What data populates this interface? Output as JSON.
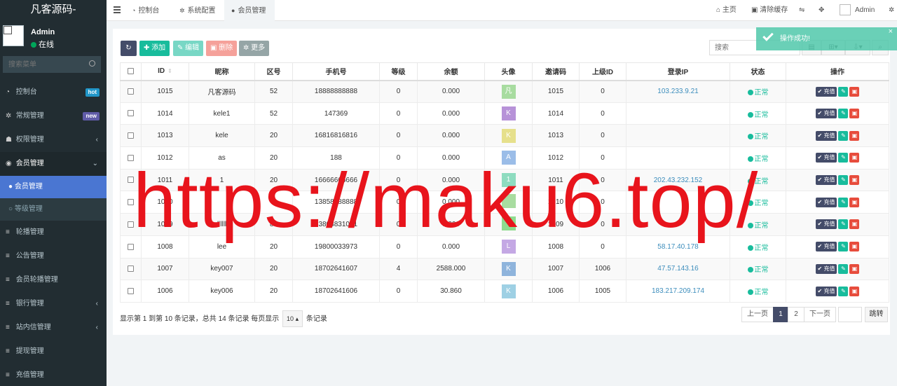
{
  "sidebar": {
    "logo": "凡客源码-",
    "user": {
      "name": "Admin",
      "status": "在线"
    },
    "search_placeholder": "搜索菜单",
    "items": [
      {
        "label": "控制台",
        "icon": "dashboard-icon",
        "badge": "hot"
      },
      {
        "label": "常规管理",
        "icon": "cogs-icon",
        "badge": "new"
      },
      {
        "label": "权限管理",
        "icon": "group-icon"
      },
      {
        "label": "会员管理",
        "icon": "user-circle-icon"
      },
      {
        "label": "轮播管理",
        "icon": "list-icon"
      },
      {
        "label": "公告管理",
        "icon": "list-icon"
      },
      {
        "label": "会员轮播管理",
        "icon": "list-icon"
      },
      {
        "label": "银行管理",
        "icon": "list-icon"
      },
      {
        "label": "站内信管理",
        "icon": "list-icon"
      },
      {
        "label": "提现管理",
        "icon": "list-icon"
      },
      {
        "label": "充值管理",
        "icon": "list-icon"
      }
    ],
    "sub_items": [
      {
        "label": "会员管理"
      },
      {
        "label": "等级管理"
      }
    ]
  },
  "topbar": {
    "tabs": [
      {
        "label": "控制台",
        "icon": "dashboard-icon"
      },
      {
        "label": "系统配置",
        "icon": "gear-icon"
      },
      {
        "label": "会员管理",
        "icon": "user-icon"
      }
    ],
    "right": {
      "home": "主页",
      "clear_cache": "清除缓存",
      "admin": "Admin"
    }
  },
  "toolbar": {
    "add": "添加",
    "edit": "编辑",
    "delete": "删除",
    "more": "更多",
    "search_placeholder": "搜索"
  },
  "table": {
    "headers": [
      "ID",
      "昵称",
      "区号",
      "手机号",
      "等级",
      "余额",
      "头像",
      "邀请码",
      "上级ID",
      "登录IP",
      "状态",
      "操作"
    ],
    "charge_label": "充值",
    "rows": [
      {
        "id": "1015",
        "nick": "凡客源码",
        "area": "52",
        "phone": "18888888888",
        "level": "0",
        "balance": "0.000",
        "avatar": "凡",
        "avatar_color": "#a8dca0",
        "invite": "1015",
        "parent": "0",
        "ip": "103.233.9.21",
        "status": "正常"
      },
      {
        "id": "1014",
        "nick": "kele1",
        "area": "52",
        "phone": "147369",
        "level": "0",
        "balance": "0.000",
        "avatar": "K",
        "avatar_color": "#b792d8",
        "invite": "1014",
        "parent": "0",
        "ip": "",
        "status": "正常"
      },
      {
        "id": "1013",
        "nick": "kele",
        "area": "20",
        "phone": "16816816816",
        "level": "0",
        "balance": "0.000",
        "avatar": "K",
        "avatar_color": "#e6e08c",
        "invite": "1013",
        "parent": "0",
        "ip": "",
        "status": "正常"
      },
      {
        "id": "1012",
        "nick": "as",
        "area": "20",
        "phone": "188",
        "level": "0",
        "balance": "0.000",
        "avatar": "A",
        "avatar_color": "#9bbde8",
        "invite": "1012",
        "parent": "0",
        "ip": "",
        "status": "正常"
      },
      {
        "id": "1011",
        "nick": "1",
        "area": "20",
        "phone": "16666666666",
        "level": "0",
        "balance": "0.000",
        "avatar": "1",
        "avatar_color": "#8edcc0",
        "invite": "1011",
        "parent": "0",
        "ip": "202.43.232.152",
        "status": "正常"
      },
      {
        "id": "1010",
        "nick": "",
        "area": "0",
        "phone": "13858888888",
        "level": "0",
        "balance": "0.000",
        "avatar": "",
        "avatar_color": "#a8dca0",
        "invite": "1010",
        "parent": "0",
        "ip": "",
        "status": "正常"
      },
      {
        "id": "1009",
        "nick": "llllll",
        "area": "86",
        "phone": "13808831081",
        "level": "0",
        "balance": "0.000",
        "avatar": "",
        "avatar_color": "#8edc8e",
        "invite": "1009",
        "parent": "0",
        "ip": "",
        "status": "正常"
      },
      {
        "id": "1008",
        "nick": "lee",
        "area": "20",
        "phone": "19800033973",
        "level": "0",
        "balance": "0.000",
        "avatar": "L",
        "avatar_color": "#c4a8e4",
        "invite": "1008",
        "parent": "0",
        "ip": "58.17.40.178",
        "status": "正常"
      },
      {
        "id": "1007",
        "nick": "key007",
        "area": "20",
        "phone": "18702641607",
        "level": "4",
        "balance": "2588.000",
        "avatar": "K",
        "avatar_color": "#8fb4dc",
        "invite": "1007",
        "parent": "1006",
        "ip": "47.57.143.16",
        "status": "正常"
      },
      {
        "id": "1006",
        "nick": "key006",
        "area": "20",
        "phone": "18702641606",
        "level": "0",
        "balance": "30.860",
        "avatar": "K",
        "avatar_color": "#9ed0e4",
        "invite": "1006",
        "parent": "1005",
        "ip": "183.217.209.174",
        "status": "正常"
      }
    ]
  },
  "footer": {
    "info_prefix": "显示第 1 到第 10 条记录，总共 14 条记录 每页显示",
    "page_size": "10",
    "info_suffix": "条记录",
    "prev": "上一页",
    "pages": [
      "1",
      "2"
    ],
    "next": "下一页",
    "jump": "跳转"
  },
  "toast": {
    "text": "操作成功!",
    "close": "×"
  },
  "watermark": "https://maku6.top/",
  "colors": {
    "sidebar_bg": "#222d32",
    "active_blue": "#4a76d2",
    "primary_dark": "#444c69",
    "success": "#18bc9c",
    "danger": "#e74c3c"
  }
}
